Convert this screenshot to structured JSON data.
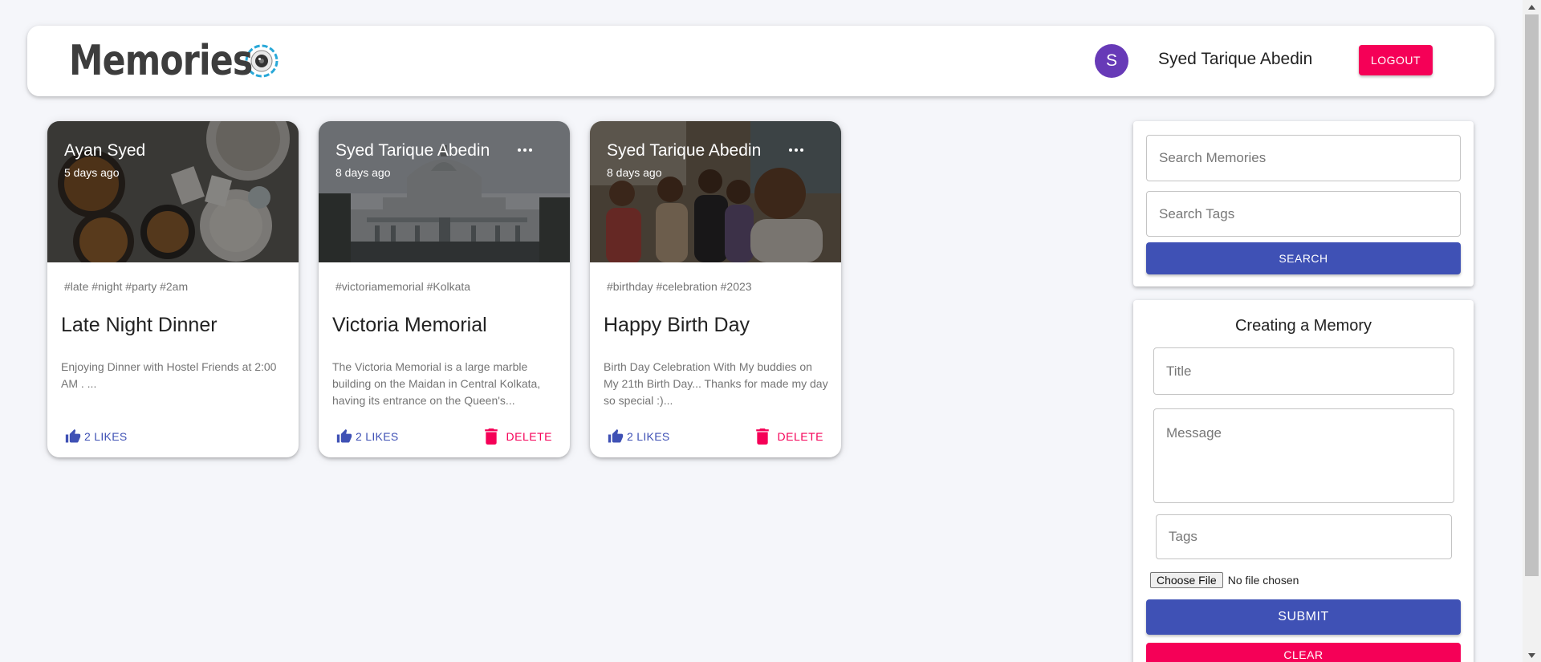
{
  "app": {
    "brand": "Memories",
    "user_initial": "S",
    "user_name": "Syed Tarique Abedin",
    "logout_label": "LOGOUT"
  },
  "posts": [
    {
      "author": "Ayan Syed",
      "time": "5 days ago",
      "tags": "#late #night #party #2am",
      "title": "Late Night Dinner",
      "message": "Enjoying Dinner with Hostel Friends at 2:00 AM . ...",
      "likes": "2 LIKES",
      "image": "food-plates-photo"
    },
    {
      "author": "Syed Tarique Abedin",
      "time": "8 days ago",
      "tags": "#victoriamemorial #Kolkata",
      "title": "Victoria Memorial",
      "message": "The Victoria Memorial is a large marble building on the Maidan in Central Kolkata, having its entrance on the Queen's...",
      "likes": "2 LIKES",
      "delete": "DELETE",
      "image": "victoria-memorial-photo"
    },
    {
      "author": "Syed Tarique Abedin",
      "time": "8 days ago",
      "tags": "#birthday #celebration #2023",
      "title": "Happy Birth Day",
      "message": "Birth Day Celebration With My buddies on My 21th Birth Day... Thanks for made my day so special :)...",
      "likes": "2 LIKES",
      "delete": "DELETE",
      "image": "group-selfie-photo"
    }
  ],
  "search": {
    "memories_placeholder": "Search Memories",
    "tags_placeholder": "Search Tags",
    "button": "SEARCH"
  },
  "form": {
    "title": "Creating a Memory",
    "title_placeholder": "Title",
    "message_placeholder": "Message",
    "tags_placeholder": "Tags",
    "file_button": "Choose File",
    "file_status": "No file chosen",
    "submit": "SUBMIT",
    "clear": "CLEAR"
  },
  "colors": {
    "primary": "#3f51b5",
    "secondary": "#f50057",
    "avatar": "#673ab7",
    "background": "#f5f6fa"
  }
}
